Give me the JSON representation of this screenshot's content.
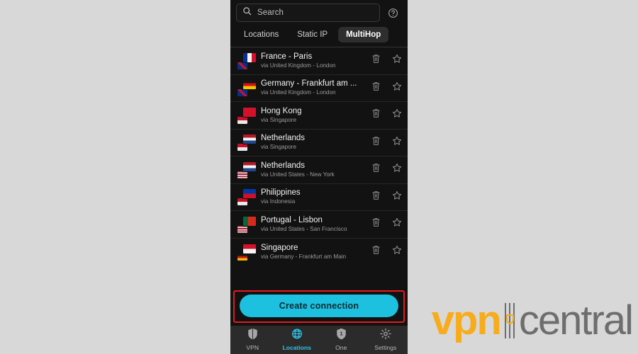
{
  "colors": {
    "page_background": "#d8d8d8",
    "app_background": "#121212",
    "accent_cyan": "#1dc0df",
    "highlight_red": "#e41b1b",
    "nav_bar": "#2b2b2b",
    "watermark_orange": "#f7ac1c",
    "watermark_gray": "#6e6e6e"
  },
  "search": {
    "placeholder": "Search",
    "value": "",
    "icon": "search-icon",
    "help_icon": "help-circle-icon"
  },
  "tabs": [
    {
      "label": "Locations",
      "active": false
    },
    {
      "label": "Static IP",
      "active": false
    },
    {
      "label": "MultiHop",
      "active": true
    }
  ],
  "list": {
    "row_actions": {
      "delete_icon": "trash-icon",
      "favorite_icon": "star-outline-icon"
    },
    "rows": [
      {
        "title": "France - Paris",
        "subtitle": "via United Kingdom - London",
        "front_flag": "fr",
        "back_flag": "gb"
      },
      {
        "title": "Germany - Frankfurt am ...",
        "subtitle": "via United Kingdom - London",
        "front_flag": "de",
        "back_flag": "gb"
      },
      {
        "title": "Hong Kong",
        "subtitle": "via Singapore",
        "front_flag": "hk",
        "back_flag": "sg"
      },
      {
        "title": "Netherlands",
        "subtitle": "via Singapore",
        "front_flag": "nl",
        "back_flag": "sg"
      },
      {
        "title": "Netherlands",
        "subtitle": "via United States - New York",
        "front_flag": "nl",
        "back_flag": "us"
      },
      {
        "title": "Philippines",
        "subtitle": "via Indonesia",
        "front_flag": "ph",
        "back_flag": "id"
      },
      {
        "title": "Portugal - Lisbon",
        "subtitle": "via United States - San Francisco",
        "front_flag": "pt",
        "back_flag": "us"
      },
      {
        "title": "Singapore",
        "subtitle": "via Germany - Frankfurt am Main",
        "front_flag": "sg",
        "back_flag": "de"
      }
    ]
  },
  "cta": {
    "label": "Create connection",
    "highlighted": true
  },
  "bottom_nav": [
    {
      "label": "VPN",
      "icon": "shield-icon",
      "active": false
    },
    {
      "label": "Locations",
      "icon": "globe-icon",
      "active": true
    },
    {
      "label": "One",
      "icon": "shield-one-icon",
      "active": false
    },
    {
      "label": "Settings",
      "icon": "gear-icon",
      "active": false
    }
  ],
  "watermark": {
    "text_primary": "vpn",
    "text_secondary": "central"
  }
}
